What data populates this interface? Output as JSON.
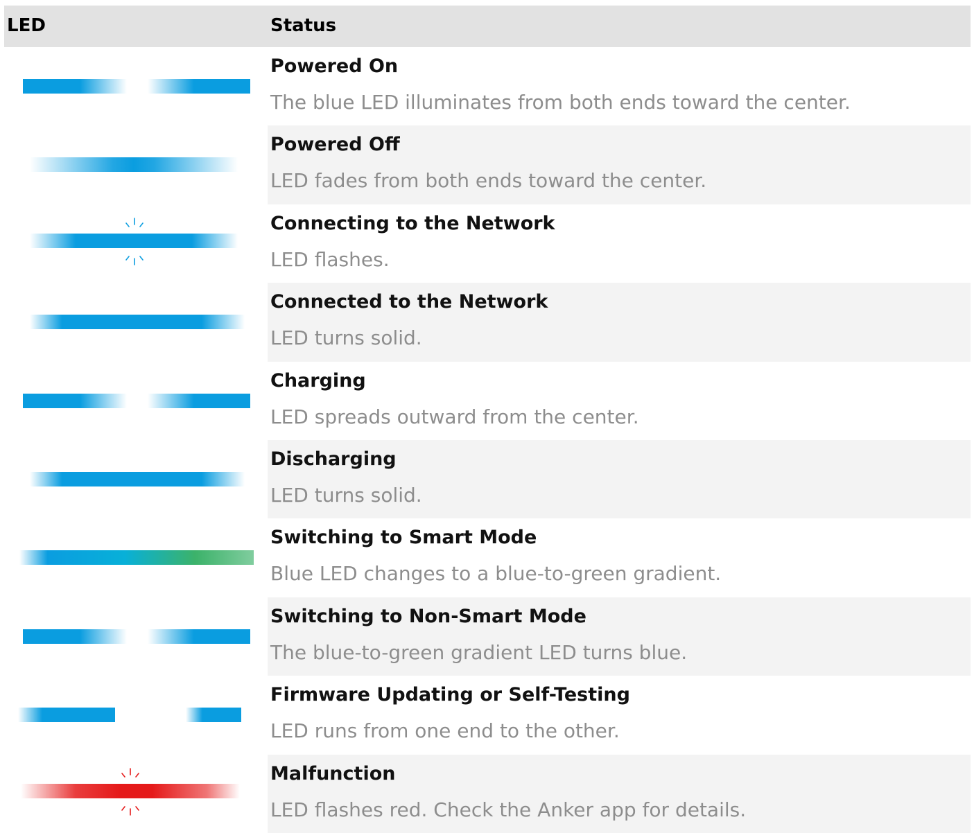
{
  "header": {
    "led": "LED",
    "status": "Status"
  },
  "colors": {
    "blue": "#0a9de0",
    "green": "#3cb26a",
    "red": "#e51a1a",
    "header_bg": "#e2e2e2",
    "row_shade": "#f3f3f3"
  },
  "rows": [
    {
      "title": "Powered On",
      "desc": "The blue LED illuminates from both ends toward the center.",
      "led": "blue-ends-on"
    },
    {
      "title": "Powered Off",
      "desc": "LED fades from both ends toward the center.",
      "led": "blue-center"
    },
    {
      "title": "Connecting to the Network",
      "desc": "LED flashes.",
      "led": "blue-flash"
    },
    {
      "title": "Connected to the Network",
      "desc": "LED turns solid.",
      "led": "blue-solid"
    },
    {
      "title": "Charging",
      "desc": "LED spreads outward from the center.",
      "led": "blue-ends-on"
    },
    {
      "title": "Discharging",
      "desc": "LED turns solid.",
      "led": "blue-solid"
    },
    {
      "title": "Switching to Smart Mode",
      "desc": "Blue LED changes to a blue-to-green gradient.",
      "led": "blue-green"
    },
    {
      "title": "Switching to Non-Smart Mode",
      "desc": "The blue-to-green gradient LED turns blue.",
      "led": "blue-ends-on"
    },
    {
      "title": "Firmware Updating or Self-Testing",
      "desc": "LED runs from one end to the other.",
      "led": "blue-run"
    },
    {
      "title": "Malfunction",
      "desc": "LED flashes red. Check the Anker app for details.",
      "led": "red-flash"
    }
  ]
}
